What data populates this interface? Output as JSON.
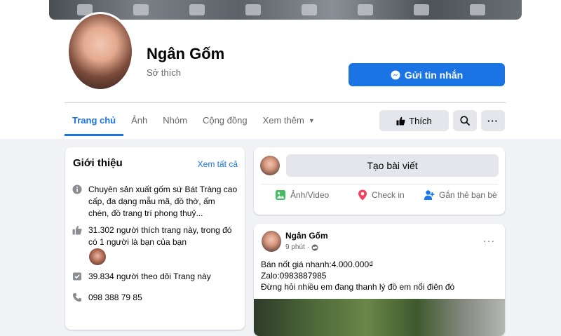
{
  "page": {
    "name": "Ngân Gốm",
    "category": "Sở thích",
    "message_button": "Gửi tin nhắn"
  },
  "tabs": [
    {
      "label": "Trang chủ",
      "active": true
    },
    {
      "label": "Ảnh"
    },
    {
      "label": "Nhóm"
    },
    {
      "label": "Cộng đồng"
    },
    {
      "label": "Xem thêm"
    }
  ],
  "actions": {
    "like_label": "Thích",
    "search_icon": "search-icon",
    "more_icon": "more-icon"
  },
  "intro": {
    "title": "Giới thiệu",
    "see_all": "Xem tất cả",
    "description": "Chuyên sản xuất gốm sứ Bát Tràng cao cấp, đa dạng mẫu mã, đồ thờ, ấm chén, đồ trang trí phong thuỷ...",
    "likes": "31.302 người thích trang này, trong đó có 1 người là bạn của bạn",
    "followers": "39.834 người theo dõi Trang này",
    "phone": "098 388 79 85"
  },
  "create_post": {
    "composer": "Tạo bài viết",
    "photo_video": "Ảnh/Video",
    "check_in": "Check in",
    "tag_friends": "Gắn thẻ bạn bè"
  },
  "post": {
    "author": "Ngân Gốm",
    "time": "9 phút",
    "line1": "Bán nốt giá nhanh:4.000.000₫",
    "line2": "Zalo:0983887985",
    "line3": "Đừng hỏi nhiều em đang thanh lý đồ em nổi điên đó"
  },
  "colors": {
    "accent": "#1b74e4",
    "background": "#f0f2f5",
    "secondary_text": "#65676b",
    "button_gray": "#e4e6eb"
  }
}
